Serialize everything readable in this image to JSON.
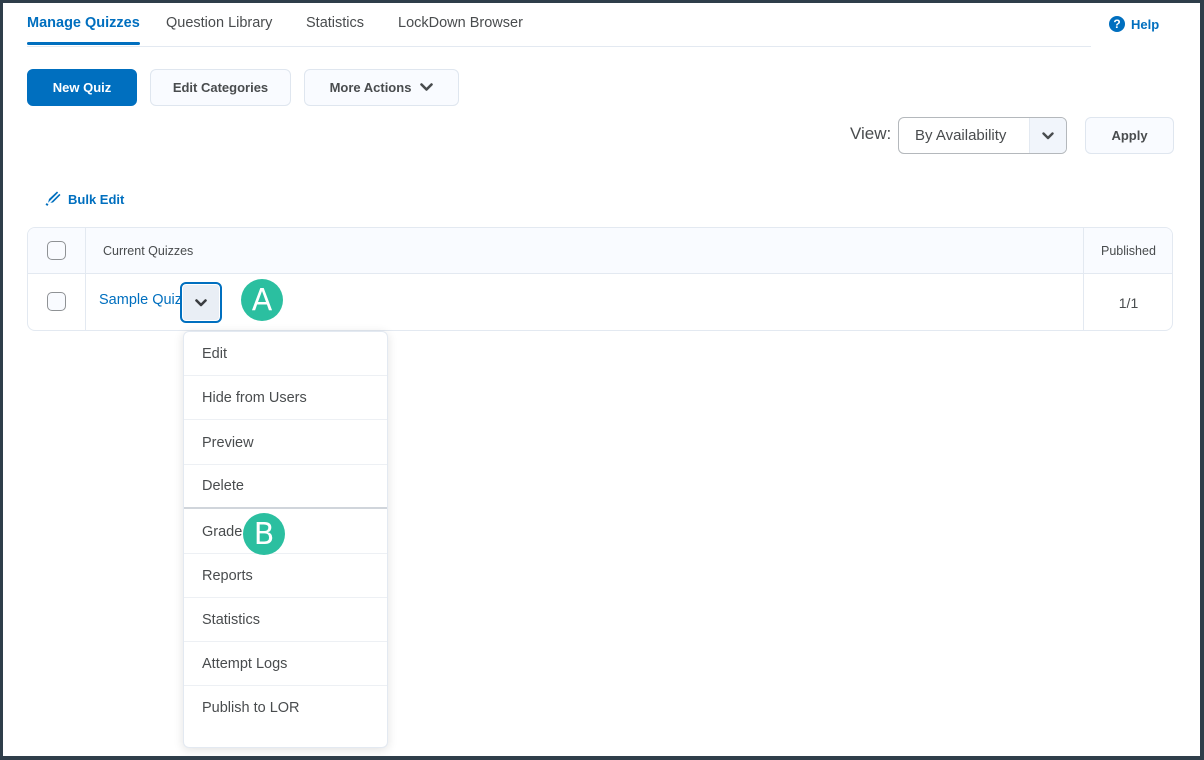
{
  "tabs": [
    {
      "label": "Manage Quizzes",
      "active": true
    },
    {
      "label": "Question Library",
      "active": false
    },
    {
      "label": "Statistics",
      "active": false
    },
    {
      "label": "LockDown Browser",
      "active": false
    }
  ],
  "help": {
    "label": "Help",
    "icon": "help-circle-icon"
  },
  "toolbar": {
    "new_quiz": "New Quiz",
    "edit_categories": "Edit Categories",
    "more_actions": "More Actions"
  },
  "view": {
    "label": "View:",
    "selected": "By Availability",
    "apply": "Apply"
  },
  "bulk_edit": {
    "label": "Bulk Edit",
    "icon": "pencil-icon"
  },
  "table": {
    "columns": [
      "Current Quizzes",
      "Published"
    ],
    "rows": [
      {
        "name": "Sample Quiz",
        "published": "1/1"
      }
    ]
  },
  "context_menu": {
    "items": [
      "Edit",
      "Hide from Users",
      "Preview",
      "Delete",
      "Grade",
      "Reports",
      "Statistics",
      "Attempt Logs",
      "Publish to LOR"
    ]
  },
  "callouts": {
    "a": "A",
    "b": "B",
    "color": "#2bbfa0"
  },
  "colors": {
    "accent": "#006fbf"
  }
}
